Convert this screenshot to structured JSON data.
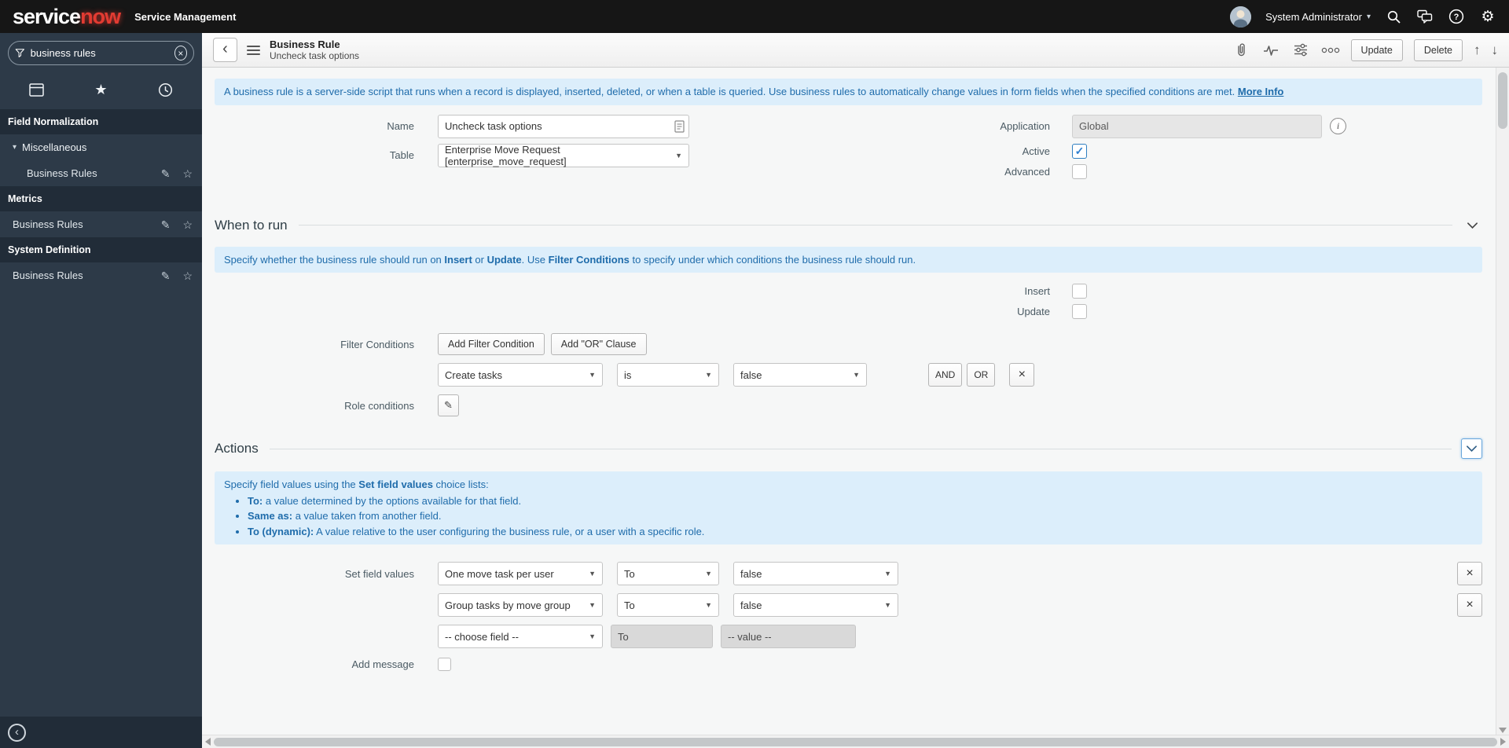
{
  "header": {
    "logo_service": "service",
    "logo_now": "now",
    "product_label": "Service Management",
    "user_name": "System Administrator"
  },
  "icons": {
    "user_caret": "▾",
    "tree_caret": "▾",
    "select_caret": "▼",
    "star": "★",
    "star_outline": "☆",
    "pencil": "✎",
    "gear": "⚙",
    "close": "×",
    "check": "✓",
    "arrow_up": "↑",
    "arrow_down": "↓",
    "info": "i",
    "back_chevron": "‹",
    "collapse_arrow": "‹"
  },
  "sidebar": {
    "search_value": "business rules",
    "nav": {
      "app1": "Field Normalization",
      "group1": "Miscellaneous",
      "module1": "Business Rules",
      "app2": "Metrics",
      "module2": "Business Rules",
      "app3": "System Definition",
      "module3": "Business Rules"
    }
  },
  "toolbar": {
    "title": "Business Rule",
    "subtitle": "Uncheck task options",
    "update_label": "Update",
    "delete_label": "Delete"
  },
  "info_banner": {
    "text": "A business rule is a server-side script that runs when a record is displayed, inserted, deleted, or when a table is queried. Use business rules to automatically change values in form fields when the specified conditions are met.",
    "link": "More Info"
  },
  "form": {
    "name_label": "Name",
    "name_value": "Uncheck task options",
    "table_label": "Table",
    "table_value": "Enterprise Move Request [enterprise_move_request]",
    "application_label": "Application",
    "application_value": "Global",
    "active_label": "Active",
    "advanced_label": "Advanced"
  },
  "when_to_run": {
    "title": "When to run",
    "banner": {
      "seg1": "Specify whether the business rule should run on ",
      "bold1": "Insert",
      "seg2": " or ",
      "bold2": "Update",
      "seg3": ". Use ",
      "bold3": "Filter Conditions",
      "seg4": " to specify under which conditions the business rule should run."
    },
    "insert_label": "Insert",
    "update_label": "Update",
    "filter_conditions_label": "Filter Conditions",
    "add_filter_button": "Add Filter Condition",
    "add_or_button": "Add \"OR\" Clause",
    "condition_field": "Create tasks",
    "condition_operator": "is",
    "condition_value": "false",
    "and_button": "AND",
    "or_button": "OR",
    "role_conditions_label": "Role conditions"
  },
  "actions": {
    "title": "Actions",
    "banner": {
      "intro1": "Specify field values using the ",
      "intro_bold": "Set field values",
      "intro2": " choice lists:",
      "bullets": [
        {
          "b": "To:",
          "t": " a value determined by the options available for that field."
        },
        {
          "b": "Same as:",
          "t": " a value taken from another field."
        },
        {
          "b": "To (dynamic):",
          "t": " A value relative to the user configuring the business rule, or a user with a specific role."
        }
      ]
    },
    "set_field_values_label": "Set field values",
    "rows": [
      {
        "field": "One move task per user",
        "op": "To",
        "value": "false"
      },
      {
        "field": "Group tasks by move group",
        "op": "To",
        "value": "false"
      },
      {
        "field": "-- choose field --",
        "op": "To",
        "value": "-- value --"
      }
    ],
    "add_message_label": "Add message"
  }
}
